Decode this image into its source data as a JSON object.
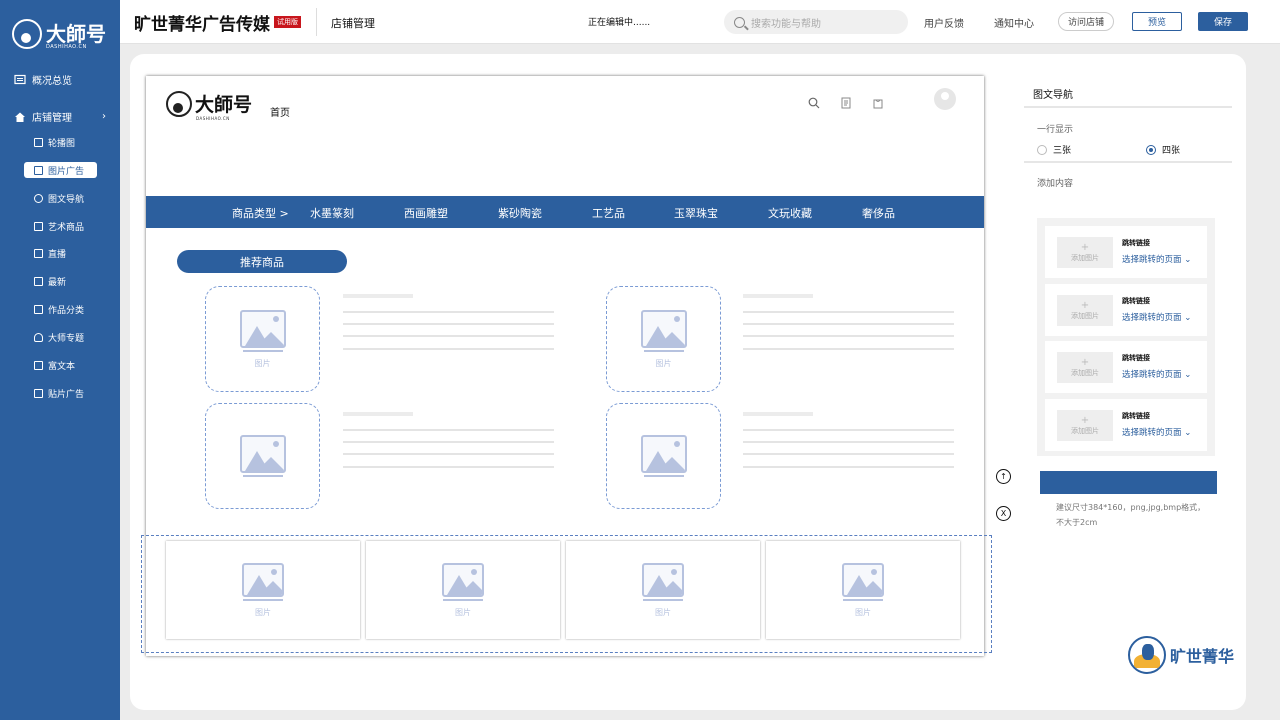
{
  "sidebar": {
    "logo": {
      "text": "大師号",
      "sub": "DASHIHAO.CN"
    },
    "overview": "概况总览",
    "shop_mgmt": "店铺管理",
    "sub_items": [
      "轮播图",
      "图片广告",
      "图文导航",
      "艺术商品",
      "直播",
      "最新",
      "作品分类",
      "大师专题",
      "富文本",
      "贴片广告"
    ],
    "active_index": 1
  },
  "header": {
    "brand": "旷世菁华广告传媒",
    "trial_badge": "试用版",
    "section": "店铺管理",
    "editing_status": "正在编辑中......",
    "search_placeholder": "搜索功能与帮助",
    "feedback": "用户反馈",
    "notifications": "通知中心",
    "visit_shop": "访问店铺",
    "preview": "预览",
    "save": "保存"
  },
  "canvas": {
    "logo_text": "大師号",
    "logo_sub": "DASHIHAO.CN",
    "home": "首页",
    "nav": [
      "商品类型 >",
      "水墨篆刻",
      "西画雕塑",
      "紫砂陶瓷",
      "工艺品",
      "玉翠珠宝",
      "文玩收藏",
      "奢侈品"
    ],
    "recommend_title": "推荐商品",
    "image_label": "图片"
  },
  "controls": {
    "up": "↑",
    "close": "X"
  },
  "right_panel": {
    "title": "图文导航",
    "row_display_label": "一行显示",
    "options": [
      "三张",
      "四张"
    ],
    "selected_option": "四张",
    "add_content_label": "添加内容",
    "items": [
      {
        "add_label": "添加图片",
        "jump_label": "跳转链接",
        "select_label": "选择跳转的页面"
      },
      {
        "add_label": "添加图片",
        "jump_label": "跳转链接",
        "select_label": "选择跳转的页面"
      },
      {
        "add_label": "添加图片",
        "jump_label": "跳转链接",
        "select_label": "选择跳转的页面"
      },
      {
        "add_label": "添加图片",
        "jump_label": "跳转链接",
        "select_label": "选择跳转的页面"
      }
    ],
    "hint_line1": "建议尺寸384*160，png,jpg,bmp格式，",
    "hint_line2": "不大于2cm"
  },
  "corner_logo": "旷世菁华",
  "colors": {
    "primary": "#2c5f9e",
    "trial_red": "#c8161d",
    "placeholder": "#b6c2df"
  }
}
